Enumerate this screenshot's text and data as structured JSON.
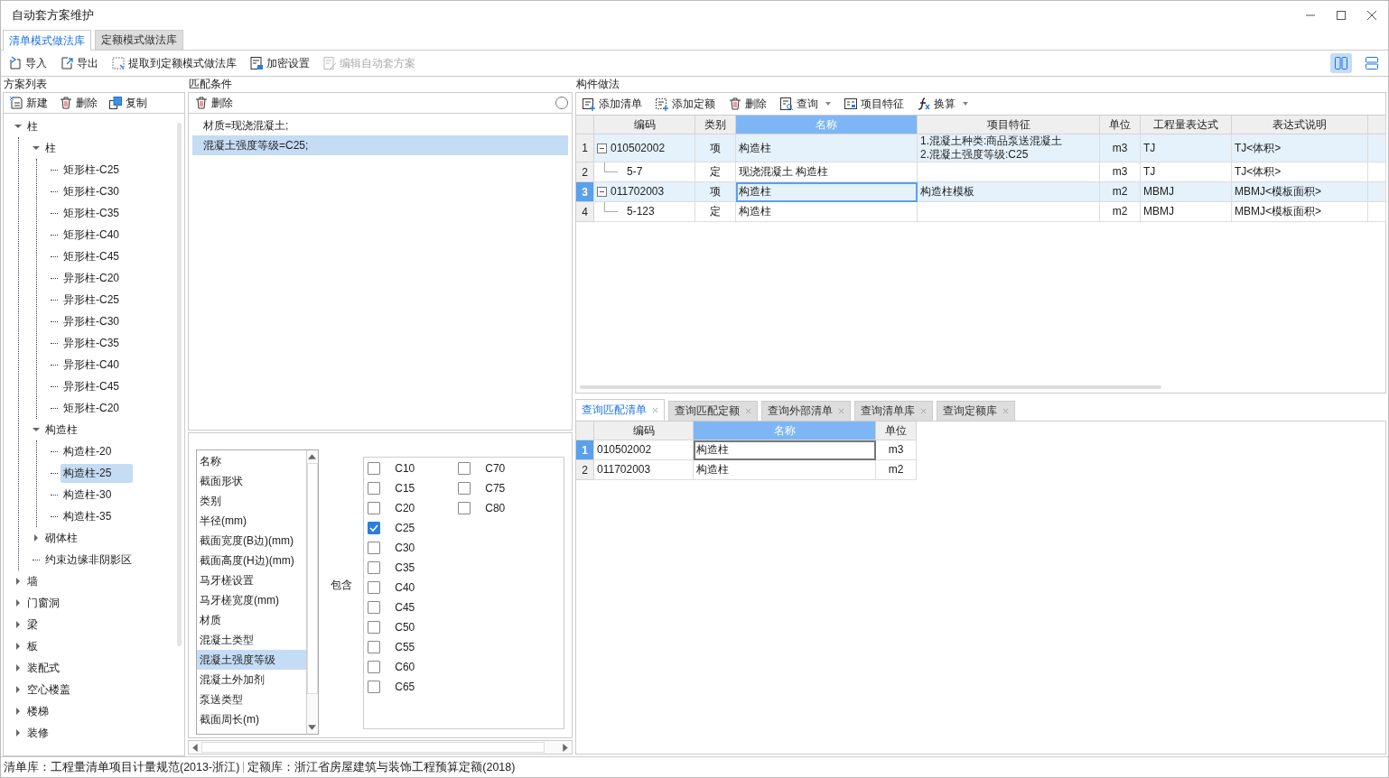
{
  "window": {
    "title": "自动套方案维护"
  },
  "mode_tabs": [
    {
      "label": "清单模式做法库",
      "selected": true
    },
    {
      "label": "定额模式做法库",
      "selected": false
    }
  ],
  "toolbar": [
    {
      "label": "导入",
      "disabled": false
    },
    {
      "label": "导出",
      "disabled": false
    },
    {
      "label": "提取到定额模式做法库",
      "disabled": false
    },
    {
      "label": "加密设置",
      "disabled": false
    },
    {
      "label": "编辑自动套方案",
      "disabled": true
    }
  ],
  "layout_toggles": [
    {
      "kind": "columns",
      "selected": true
    },
    {
      "kind": "rows",
      "selected": false
    }
  ],
  "scheme_list": {
    "title": "方案列表",
    "toolbar": [
      "新建",
      "删除",
      "复制"
    ],
    "tree": [
      {
        "label": "柱",
        "expanded": true,
        "selected": false,
        "children": [
          {
            "label": "柱",
            "expanded": true,
            "selected": false,
            "children": [
              {
                "label": "矩形柱-C25",
                "selected": false
              },
              {
                "label": "矩形柱-C30",
                "selected": false
              },
              {
                "label": "矩形柱-C35",
                "selected": false
              },
              {
                "label": "矩形柱-C40",
                "selected": false
              },
              {
                "label": "矩形柱-C45",
                "selected": false
              },
              {
                "label": "异形柱-C20",
                "selected": false
              },
              {
                "label": "异形柱-C25",
                "selected": false
              },
              {
                "label": "异形柱-C30",
                "selected": false
              },
              {
                "label": "异形柱-C35",
                "selected": false
              },
              {
                "label": "异形柱-C40",
                "selected": false
              },
              {
                "label": "异形柱-C45",
                "selected": false
              },
              {
                "label": "矩形柱-C20",
                "selected": false
              }
            ]
          },
          {
            "label": "构造柱",
            "expanded": true,
            "selected": false,
            "children": [
              {
                "label": "构造柱-20",
                "selected": false
              },
              {
                "label": "构造柱-25",
                "selected": true
              },
              {
                "label": "构造柱-30",
                "selected": false
              },
              {
                "label": "构造柱-35",
                "selected": false
              }
            ]
          },
          {
            "label": "砌体柱",
            "expanded": false,
            "selected": false
          },
          {
            "label": "约束边缘非阴影区",
            "selected": false
          }
        ]
      },
      {
        "label": "墙",
        "expanded": false,
        "selected": false
      },
      {
        "label": "门窗洞",
        "expanded": false,
        "selected": false
      },
      {
        "label": "梁",
        "expanded": false,
        "selected": false
      },
      {
        "label": "板",
        "expanded": false,
        "selected": false
      },
      {
        "label": "装配式",
        "expanded": false,
        "selected": false
      },
      {
        "label": "空心楼盖",
        "expanded": false,
        "selected": false
      },
      {
        "label": "楼梯",
        "expanded": false,
        "selected": false
      },
      {
        "label": "装修",
        "expanded": false,
        "selected": false
      }
    ]
  },
  "match_conditions": {
    "title": "匹配条件",
    "toolbar": [
      "删除"
    ],
    "conditions": [
      {
        "text": "材质=现浇混凝土;",
        "selected": false
      },
      {
        "text": "混凝土强度等级=C25;",
        "selected": true
      }
    ],
    "properties": [
      {
        "label": "名称",
        "selected": false
      },
      {
        "label": "截面形状",
        "selected": false
      },
      {
        "label": "类别",
        "selected": false
      },
      {
        "label": "半径(mm)",
        "selected": false
      },
      {
        "label": "截面宽度(B边)(mm)",
        "selected": false
      },
      {
        "label": "截面高度(H边)(mm)",
        "selected": false
      },
      {
        "label": "马牙槎设置",
        "selected": false
      },
      {
        "label": "马牙槎宽度(mm)",
        "selected": false
      },
      {
        "label": "材质",
        "selected": false
      },
      {
        "label": "混凝土类型",
        "selected": false
      },
      {
        "label": "混凝土强度等级",
        "selected": true
      },
      {
        "label": "混凝土外加剂",
        "selected": false
      },
      {
        "label": "泵送类型",
        "selected": false
      },
      {
        "label": "截面周长(m)",
        "selected": false
      }
    ],
    "operator": "包含",
    "grades": [
      {
        "label": "C10",
        "checked": false
      },
      {
        "label": "C15",
        "checked": false
      },
      {
        "label": "C20",
        "checked": false
      },
      {
        "label": "C25",
        "checked": true
      },
      {
        "label": "C30",
        "checked": false
      },
      {
        "label": "C35",
        "checked": false
      },
      {
        "label": "C40",
        "checked": false
      },
      {
        "label": "C45",
        "checked": false
      },
      {
        "label": "C50",
        "checked": false
      },
      {
        "label": "C55",
        "checked": false
      },
      {
        "label": "C60",
        "checked": false
      },
      {
        "label": "C65",
        "checked": false
      },
      {
        "label": "C70",
        "checked": false
      },
      {
        "label": "C75",
        "checked": false
      },
      {
        "label": "C80",
        "checked": false
      }
    ]
  },
  "component_method": {
    "title": "构件做法",
    "toolbar": [
      {
        "label": "添加清单",
        "dropdown": false
      },
      {
        "label": "添加定额",
        "dropdown": false
      },
      {
        "label": "删除",
        "dropdown": false
      },
      {
        "label": "查询",
        "dropdown": true
      },
      {
        "label": "项目特征",
        "dropdown": false
      },
      {
        "label": "换算",
        "dropdown": true
      }
    ],
    "columns": [
      {
        "label": "编码",
        "selected": false
      },
      {
        "label": "类别",
        "selected": false
      },
      {
        "label": "名称",
        "selected": true
      },
      {
        "label": "项目特征",
        "selected": false
      },
      {
        "label": "单位",
        "selected": false
      },
      {
        "label": "工程量表达式",
        "selected": false
      },
      {
        "label": "表达式说明",
        "selected": false
      }
    ],
    "rows": [
      {
        "num": "1",
        "selected": false,
        "expanded": true,
        "cells": [
          "010502002",
          "项",
          "构造柱",
          "1.混凝土种类:商品泵送混凝土\n2.混凝土强度等级:C25",
          "m3",
          "TJ",
          "TJ<体积>"
        ],
        "children": [
          {
            "num": "2",
            "selected": false,
            "cells": [
              "5-7",
              "定",
              "现浇混凝土 构造柱",
              "",
              "m3",
              "TJ",
              "TJ<体积>"
            ]
          }
        ]
      },
      {
        "num": "3",
        "selected": true,
        "expanded": true,
        "cells": [
          "011702003",
          "项",
          "构造柱",
          "构造柱模板",
          "m2",
          "MBMJ",
          "MBMJ<模板面积>"
        ],
        "children": [
          {
            "num": "4",
            "selected": false,
            "cells": [
              "5-123",
              "定",
              "构造柱",
              "",
              "m2",
              "MBMJ",
              "MBMJ<模板面积>"
            ]
          }
        ]
      }
    ]
  },
  "query_tabs": [
    {
      "label": "查询匹配清单",
      "selected": true
    },
    {
      "label": "查询匹配定额",
      "selected": false
    },
    {
      "label": "查询外部清单",
      "selected": false
    },
    {
      "label": "查询清单库",
      "selected": false
    },
    {
      "label": "查询定额库",
      "selected": false
    }
  ],
  "query_table": {
    "columns": [
      {
        "label": "编码",
        "selected": false
      },
      {
        "label": "名称",
        "selected": true
      },
      {
        "label": "单位",
        "selected": false
      }
    ],
    "rows": [
      {
        "num": "1",
        "selected": true,
        "cells": [
          "010502002",
          "构造柱",
          "m3"
        ]
      },
      {
        "num": "2",
        "selected": false,
        "cells": [
          "011702003",
          "构造柱",
          "m2"
        ]
      }
    ]
  },
  "status_bar": [
    "清单库：工程量清单项目计量规范(2013-浙江)",
    "定额库：浙江省房屋建筑与装饰工程预算定额(2018)"
  ]
}
